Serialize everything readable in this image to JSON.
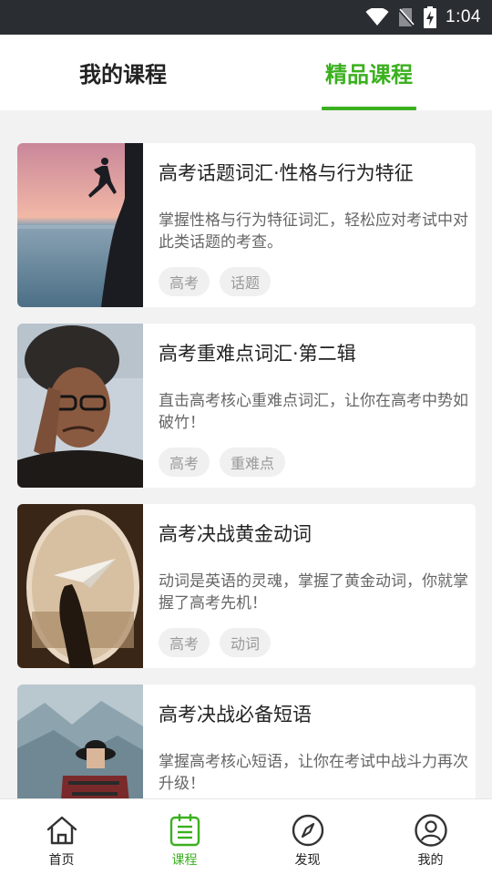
{
  "status_bar": {
    "time": "1:04",
    "icons": [
      "wifi-icon",
      "no-sim-icon",
      "battery-charging-icon"
    ]
  },
  "tabs": [
    {
      "label": "我的课程",
      "active": false
    },
    {
      "label": "精品课程",
      "active": true
    }
  ],
  "accent_color": "#3bb01f",
  "courses": [
    {
      "title": "高考话题词汇·性格与行为特征",
      "description": "掌握性格与行为特征词汇，轻松应对考试中对此类话题的考查。",
      "tags": [
        "高考",
        "话题"
      ],
      "image": "cliff-jump-sunset-photo"
    },
    {
      "title": "高考重难点词汇·第二辑",
      "description": "直击高考核心重难点词汇，让你在高考中势如破竹！",
      "tags": [
        "高考",
        "重难点"
      ],
      "image": "stressed-person-photo"
    },
    {
      "title": "高考决战黄金动词",
      "description": "动词是英语的灵魂，掌握了黄金动词，你就掌握了高考先机！",
      "tags": [
        "高考",
        "动词"
      ],
      "image": "paper-plane-window-photo"
    },
    {
      "title": "高考决战必备短语",
      "description": "掌握高考核心短语，让你在考试中战斗力再次升级！",
      "tags": [],
      "image": "mountain-hiker-photo"
    }
  ],
  "bottom_nav": [
    {
      "label": "首页",
      "icon": "home-icon",
      "active": false
    },
    {
      "label": "课程",
      "icon": "course-list-icon",
      "active": true
    },
    {
      "label": "发现",
      "icon": "compass-icon",
      "active": false
    },
    {
      "label": "我的",
      "icon": "profile-icon",
      "active": false
    }
  ]
}
